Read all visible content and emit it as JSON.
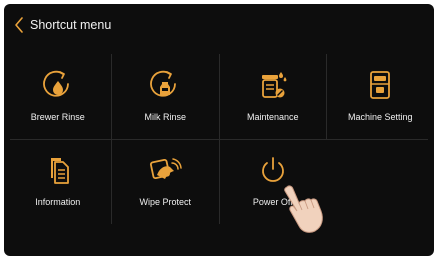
{
  "header": {
    "back_icon": "chevron-left-icon",
    "title": "Shortcut menu"
  },
  "colors": {
    "background": "#0d0d0d",
    "accent": "#e9a23b",
    "text": "#f0f0f0"
  },
  "menu": {
    "items": [
      {
        "label": "Brewer Rinse",
        "icon": "brewer-rinse-icon"
      },
      {
        "label": "Milk Rinse",
        "icon": "milk-rinse-icon"
      },
      {
        "label": "Maintenance",
        "icon": "maintenance-icon"
      },
      {
        "label": "Machine Setting",
        "icon": "machine-setting-icon"
      },
      {
        "label": "Information",
        "icon": "information-icon"
      },
      {
        "label": "Wipe Protect",
        "icon": "wipe-protect-icon"
      },
      {
        "label": "Power Off",
        "icon": "power-icon"
      }
    ]
  }
}
